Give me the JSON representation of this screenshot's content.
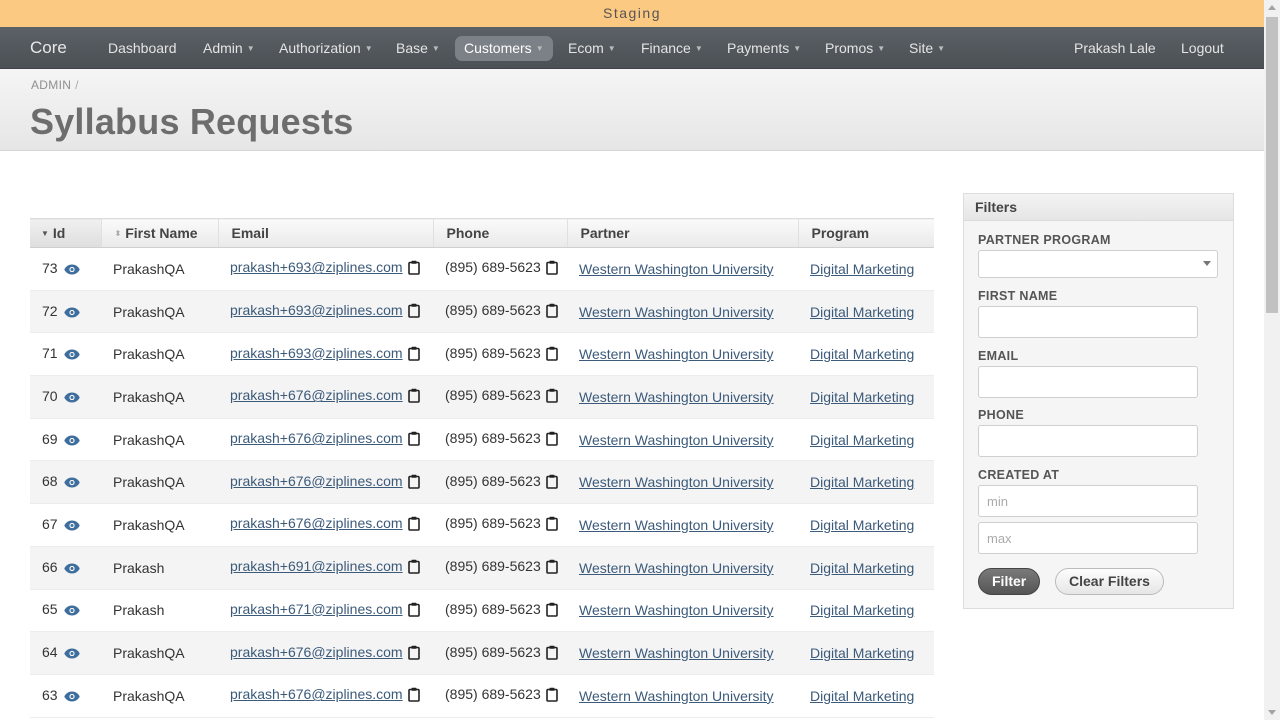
{
  "environment": "Staging",
  "nav": {
    "brand": "Core",
    "items": [
      {
        "label": "Dashboard",
        "dropdown": false
      },
      {
        "label": "Admin",
        "dropdown": true
      },
      {
        "label": "Authorization",
        "dropdown": true
      },
      {
        "label": "Base",
        "dropdown": true
      },
      {
        "label": "Customers",
        "dropdown": true,
        "active": true
      },
      {
        "label": "Ecom",
        "dropdown": true
      },
      {
        "label": "Finance",
        "dropdown": true
      },
      {
        "label": "Payments",
        "dropdown": true
      },
      {
        "label": "Promos",
        "dropdown": true
      },
      {
        "label": "Site",
        "dropdown": true
      }
    ],
    "user": "Prakash Lale",
    "logout": "Logout"
  },
  "breadcrumb": {
    "root": "ADMIN",
    "separator": "/"
  },
  "page_title": "Syllabus Requests",
  "table": {
    "columns": [
      "Id",
      "First Name",
      "Email",
      "Phone",
      "Partner",
      "Program"
    ],
    "rows": [
      {
        "id": "73",
        "first_name": "PrakashQA",
        "email": "prakash+693@ziplines.com",
        "phone": "(895) 689-5623",
        "partner": "Western Washington University",
        "program": "Digital Marketing"
      },
      {
        "id": "72",
        "first_name": "PrakashQA",
        "email": "prakash+693@ziplines.com",
        "phone": "(895) 689-5623",
        "partner": "Western Washington University",
        "program": "Digital Marketing"
      },
      {
        "id": "71",
        "first_name": "PrakashQA",
        "email": "prakash+693@ziplines.com",
        "phone": "(895) 689-5623",
        "partner": "Western Washington University",
        "program": "Digital Marketing"
      },
      {
        "id": "70",
        "first_name": "PrakashQA",
        "email": "prakash+676@ziplines.com",
        "phone": "(895) 689-5623",
        "partner": "Western Washington University",
        "program": "Digital Marketing"
      },
      {
        "id": "69",
        "first_name": "PrakashQA",
        "email": "prakash+676@ziplines.com",
        "phone": "(895) 689-5623",
        "partner": "Western Washington University",
        "program": "Digital Marketing"
      },
      {
        "id": "68",
        "first_name": "PrakashQA",
        "email": "prakash+676@ziplines.com",
        "phone": "(895) 689-5623",
        "partner": "Western Washington University",
        "program": "Digital Marketing"
      },
      {
        "id": "67",
        "first_name": "PrakashQA",
        "email": "prakash+676@ziplines.com",
        "phone": "(895) 689-5623",
        "partner": "Western Washington University",
        "program": "Digital Marketing"
      },
      {
        "id": "66",
        "first_name": "Prakash",
        "email": "prakash+691@ziplines.com",
        "phone": "(895) 689-5623",
        "partner": "Western Washington University",
        "program": "Digital Marketing"
      },
      {
        "id": "65",
        "first_name": "Prakash",
        "email": "prakash+671@ziplines.com",
        "phone": "(895) 689-5623",
        "partner": "Western Washington University",
        "program": "Digital Marketing"
      },
      {
        "id": "64",
        "first_name": "PrakashQA",
        "email": "prakash+676@ziplines.com",
        "phone": "(895) 689-5623",
        "partner": "Western Washington University",
        "program": "Digital Marketing"
      },
      {
        "id": "63",
        "first_name": "PrakashQA",
        "email": "prakash+676@ziplines.com",
        "phone": "(895) 689-5623",
        "partner": "Western Washington University",
        "program": "Digital Marketing"
      }
    ]
  },
  "filters": {
    "title": "Filters",
    "partner_program": {
      "label": "PARTNER PROGRAM",
      "value": ""
    },
    "first_name": {
      "label": "FIRST NAME",
      "value": ""
    },
    "email": {
      "label": "EMAIL",
      "value": ""
    },
    "phone": {
      "label": "PHONE",
      "value": ""
    },
    "created_at": {
      "label": "CREATED AT",
      "min_placeholder": "min",
      "max_placeholder": "max"
    },
    "filter_button": "Filter",
    "clear_button": "Clear Filters"
  }
}
